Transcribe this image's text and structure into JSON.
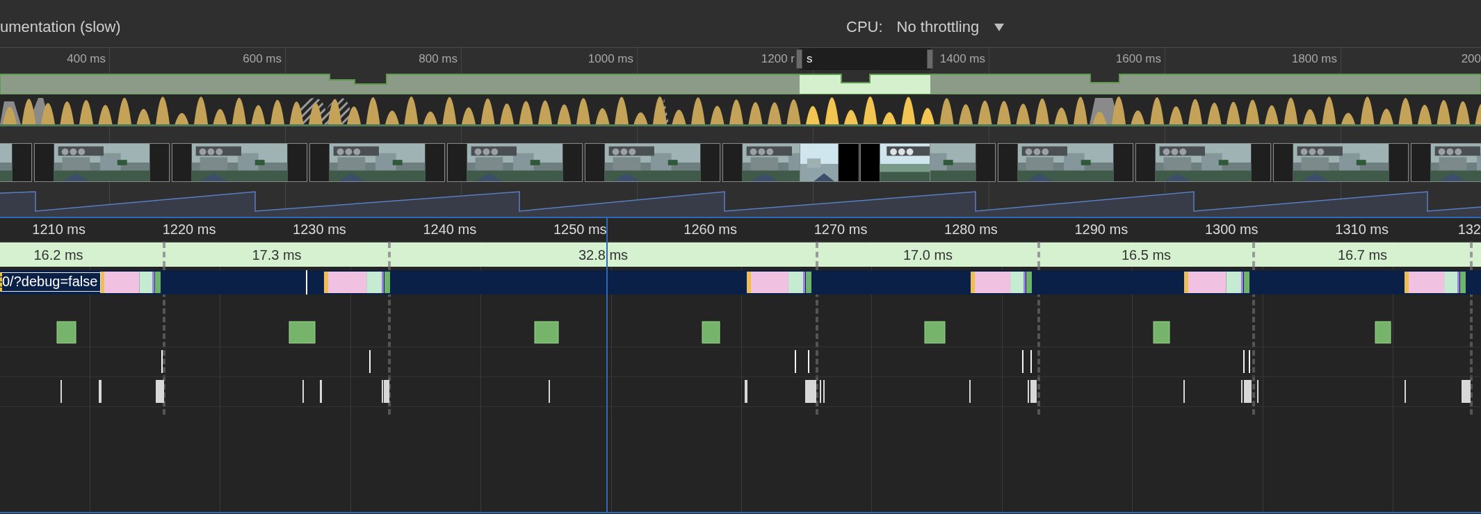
{
  "toolbar": {
    "setting_label": "umentation (slow)",
    "cpu_label": "CPU:",
    "cpu_value": "No throttling"
  },
  "overview": {
    "ticks": [
      "400 ms",
      "600 ms",
      "800 ms",
      "1000 ms",
      "1200 r",
      "1400 ms",
      "1600 ms",
      "1800 ms",
      "200"
    ],
    "selection_fragment": "s"
  },
  "ruler": {
    "ticks": [
      "1210 ms",
      "1220 ms",
      "1230 ms",
      "1240 ms",
      "1250 ms",
      "1260 ms",
      "1270 ms",
      "1280 ms",
      "1290 ms",
      "1300 ms",
      "1310 ms",
      "132"
    ]
  },
  "frames": [
    {
      "duration": "16.2 ms"
    },
    {
      "duration": "17.3 ms"
    },
    {
      "duration": "32.8 ms"
    },
    {
      "duration": "17.0 ms"
    },
    {
      "duration": "16.5 ms"
    },
    {
      "duration": "16.7 ms"
    }
  ],
  "main_thread": {
    "label": "0/?debug=false"
  }
}
